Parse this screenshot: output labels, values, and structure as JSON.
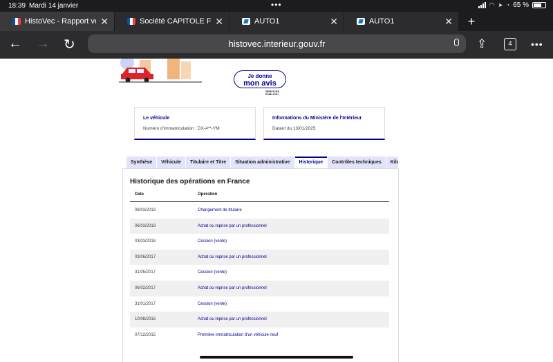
{
  "status_bar": {
    "time": "18:39",
    "date": "Mardi 14 janvier",
    "battery": "65 %"
  },
  "browser_tabs": [
    {
      "title": "HistoVec - Rapport vendeur",
      "favicon": "french-flag-icon",
      "active": true
    },
    {
      "title": "Société CAPITOLE FINANCE",
      "favicon": "marianne-icon",
      "active": false
    },
    {
      "title": "AUTO1",
      "favicon": "auto1-icon",
      "active": false
    },
    {
      "title": "AUTO1",
      "favicon": "auto1-icon",
      "active": false
    }
  ],
  "toolbar": {
    "url": "histovec.interieur.gouv.fr",
    "tab_count": "4"
  },
  "feedback": {
    "line1": "Je donne",
    "line2": "mon avis",
    "logo_line1": "SERVICES",
    "logo_line2": "PUBLICS"
  },
  "cards": {
    "vehicle": {
      "title": "Le véhicule",
      "value": "Numéro d'immatriculation : DX-4**-YM"
    },
    "ministry": {
      "title": "Informations du Ministère de l'Intérieur",
      "value": "Datant du 13/01/2025"
    }
  },
  "page_tabs": [
    {
      "label": "Synthèse",
      "active": false
    },
    {
      "label": "Véhicule",
      "active": false
    },
    {
      "label": "Titulaire et Titre",
      "active": false
    },
    {
      "label": "Situation administrative",
      "active": false
    },
    {
      "label": "Historique",
      "active": true
    },
    {
      "label": "Contrôles techniques",
      "active": false
    },
    {
      "label": "Kilométrage",
      "active": false
    }
  ],
  "history": {
    "title": "Historique des opérations en France",
    "col_date": "Date",
    "col_operation": "Opération",
    "rows": [
      {
        "date": "08/03/2018",
        "operation": "Changement de titulaire"
      },
      {
        "date": "06/03/2018",
        "operation": "Achat ou reprise par un professionnel"
      },
      {
        "date": "03/03/2018",
        "operation": "Cession (vente)"
      },
      {
        "date": "03/06/2017",
        "operation": "Achat ou reprise par un professionnel"
      },
      {
        "date": "31/05/2017",
        "operation": "Cession (vente)"
      },
      {
        "date": "06/02/2017",
        "operation": "Achat ou reprise par un professionnel"
      },
      {
        "date": "31/01/2017",
        "operation": "Cession (vente)"
      },
      {
        "date": "10/08/2016",
        "operation": "Achat ou reprise par un professionnel"
      },
      {
        "date": "07/12/2015",
        "operation": "Première immatriculation d'un véhicule neuf"
      }
    ]
  }
}
